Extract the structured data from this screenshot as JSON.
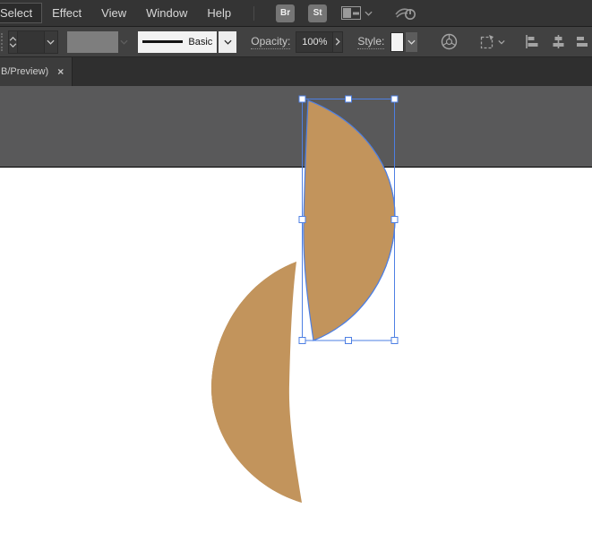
{
  "menu_bar": {
    "items": [
      "Select",
      "Effect",
      "View",
      "Window",
      "Help"
    ],
    "br_button": "Br",
    "st_button": "St"
  },
  "control_bar": {
    "brush_definition": "Basic",
    "opacity_label": "Opacity:",
    "opacity_value": "100%",
    "style_label": "Style:"
  },
  "tab_bar": {
    "active_tab_title": "B/Preview)",
    "close_glyph": "×"
  },
  "colors": {
    "selection_blue": "#4D7FE3",
    "handle_fill": "#FFFFFF",
    "shape_light": "#C2945C",
    "shape_dark": "#A37B48",
    "pasteboard": "#59595A",
    "artboard": "#FFFFFF",
    "artboard_edge": "#000000"
  }
}
